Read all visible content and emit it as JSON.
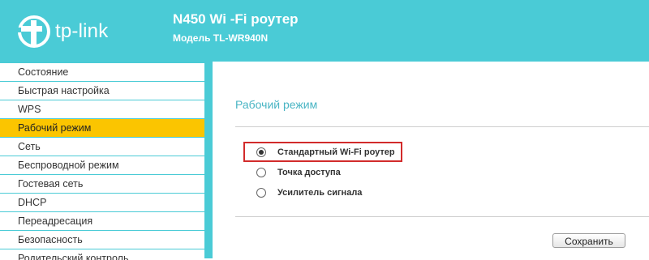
{
  "brand": {
    "logo_text": "tp-link",
    "accent_color": "#4acbd6",
    "active_color": "#fbc500"
  },
  "header": {
    "title": "N450 Wi -Fi роутер",
    "model": "Модель TL-WR940N"
  },
  "sidebar": {
    "items": [
      {
        "label": "Состояние"
      },
      {
        "label": "Быстрая настройка"
      },
      {
        "label": "WPS"
      },
      {
        "label": "Рабочий режим",
        "active": true
      },
      {
        "label": "Сеть"
      },
      {
        "label": "Беспроводной режим"
      },
      {
        "label": "Гостевая сеть"
      },
      {
        "label": "DHCP"
      },
      {
        "label": "Переадресация"
      },
      {
        "label": "Безопасность"
      },
      {
        "label": "Родительский контроль"
      }
    ]
  },
  "main": {
    "section_title": "Рабочий режим",
    "options": [
      {
        "label": "Стандартный Wi-Fi роутер",
        "checked": true
      },
      {
        "label": "Точка доступа",
        "checked": false
      },
      {
        "label": "Усилитель сигнала",
        "checked": false
      }
    ],
    "save_label": "Сохранить"
  }
}
